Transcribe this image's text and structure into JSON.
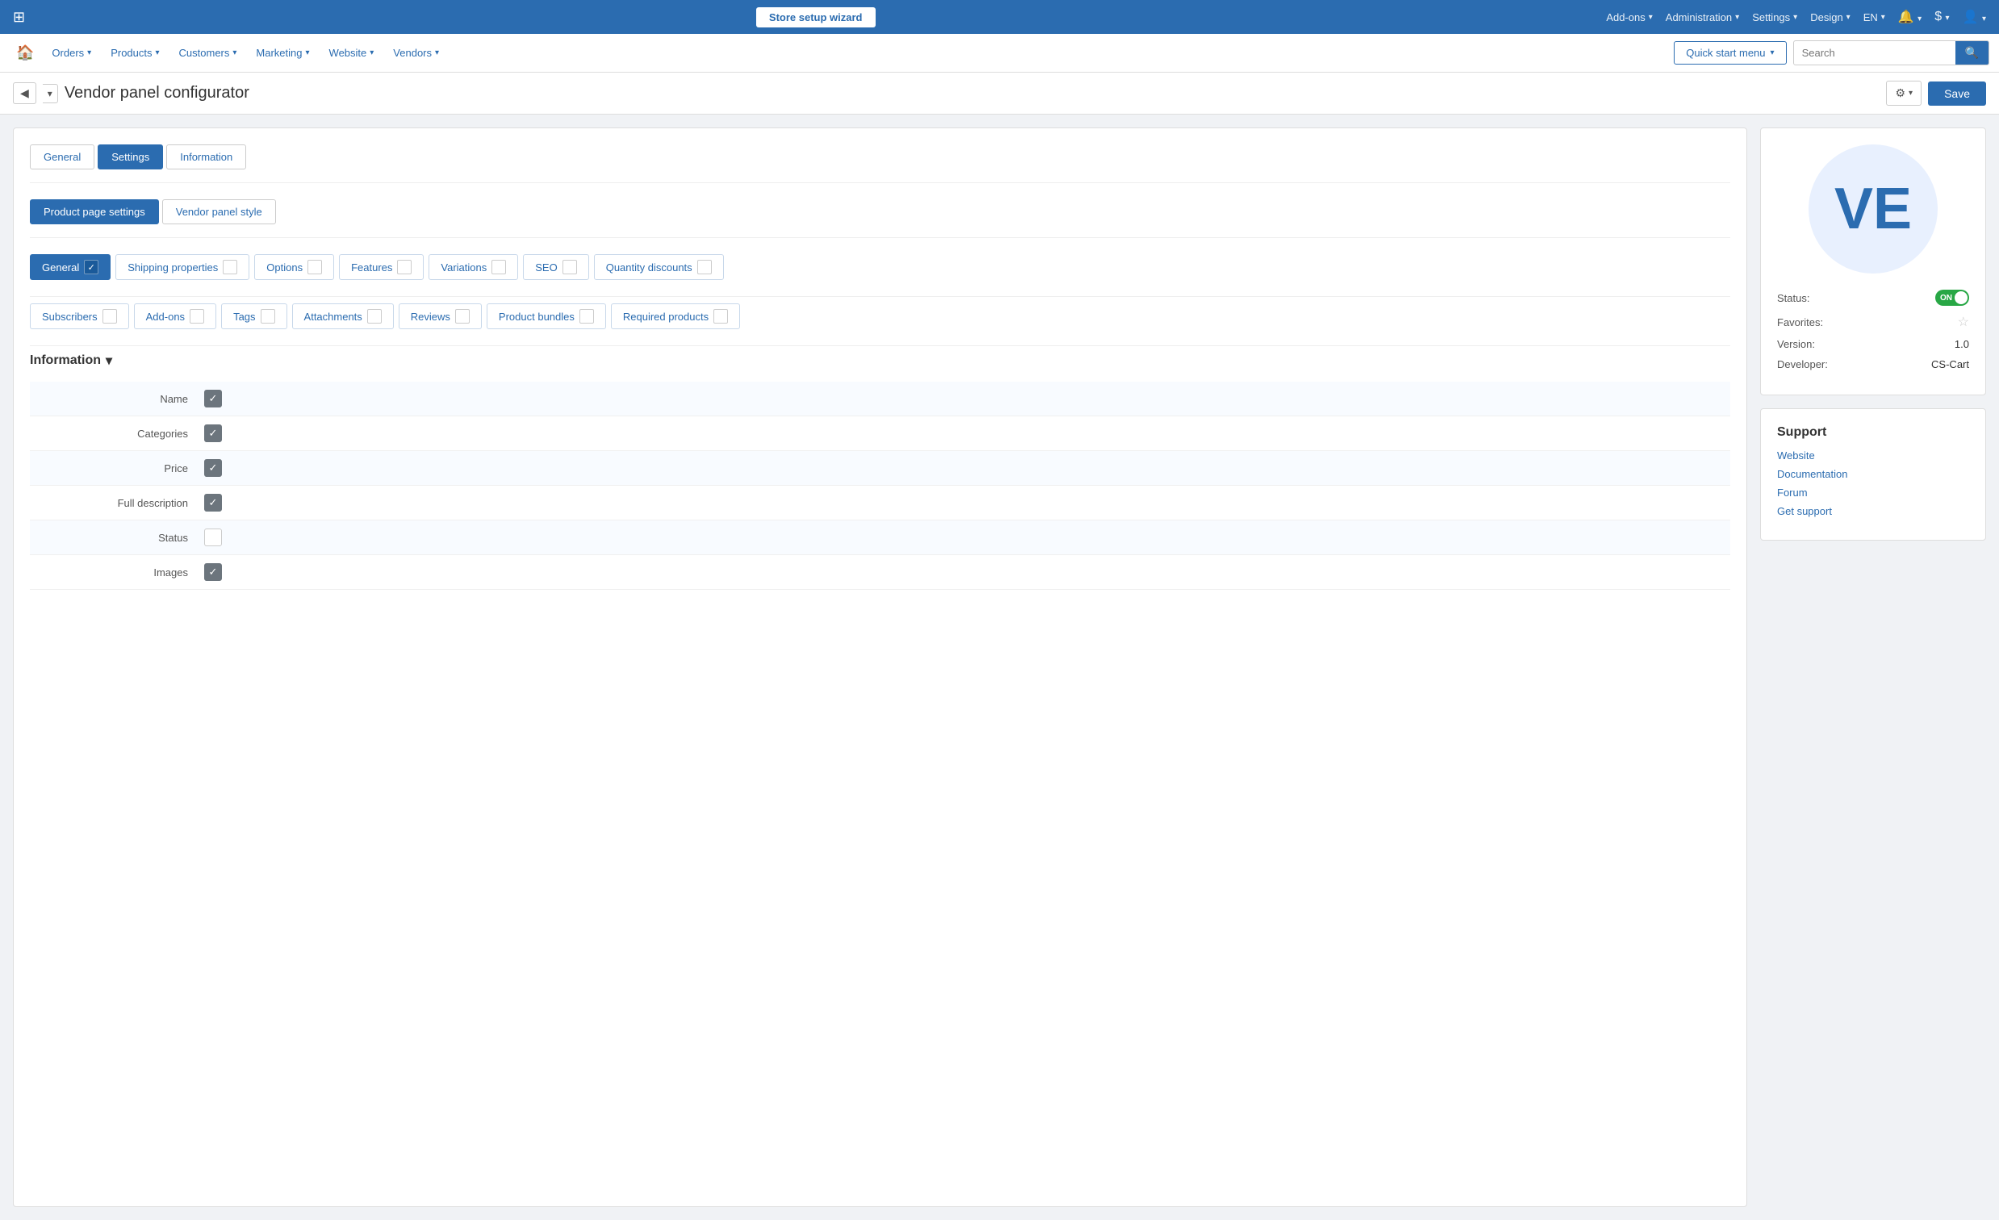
{
  "topbar": {
    "store_setup_label": "Store setup wizard",
    "nav_items": [
      {
        "label": "Add-ons",
        "id": "addons"
      },
      {
        "label": "Administration",
        "id": "administration"
      },
      {
        "label": "Settings",
        "id": "settings"
      },
      {
        "label": "Design",
        "id": "design"
      },
      {
        "label": "EN",
        "id": "lang"
      },
      {
        "label": "🔔",
        "id": "notifications"
      },
      {
        "label": "$",
        "id": "currency"
      },
      {
        "label": "👤",
        "id": "user"
      }
    ]
  },
  "navbar": {
    "home_icon": "⌂",
    "items": [
      {
        "label": "Orders",
        "id": "orders"
      },
      {
        "label": "Products",
        "id": "products"
      },
      {
        "label": "Customers",
        "id": "customers"
      },
      {
        "label": "Marketing",
        "id": "marketing"
      },
      {
        "label": "Website",
        "id": "website"
      },
      {
        "label": "Vendors",
        "id": "vendors"
      }
    ],
    "quick_start_label": "Quick start menu",
    "search_placeholder": "Search"
  },
  "page_header": {
    "title": "Vendor panel configurator",
    "save_label": "Save"
  },
  "tabs": {
    "main": [
      {
        "label": "General",
        "id": "general",
        "active": false
      },
      {
        "label": "Settings",
        "id": "settings",
        "active": true
      },
      {
        "label": "Information",
        "id": "information",
        "active": false
      }
    ],
    "sub": [
      {
        "label": "Product page settings",
        "id": "product-page-settings",
        "active": true
      },
      {
        "label": "Vendor panel style",
        "id": "vendor-panel-style",
        "active": false
      }
    ]
  },
  "feature_pills": {
    "row1": [
      {
        "label": "General",
        "id": "general",
        "active": true,
        "checked": true
      },
      {
        "label": "Shipping properties",
        "id": "shipping",
        "active": false,
        "checked": false
      },
      {
        "label": "Options",
        "id": "options",
        "active": false,
        "checked": false
      },
      {
        "label": "Features",
        "id": "features",
        "active": false,
        "checked": false
      },
      {
        "label": "Variations",
        "id": "variations",
        "active": false,
        "checked": false
      },
      {
        "label": "SEO",
        "id": "seo",
        "active": false,
        "checked": false
      },
      {
        "label": "Quantity discounts",
        "id": "quantity-discounts",
        "active": false,
        "checked": false
      }
    ],
    "row2": [
      {
        "label": "Subscribers",
        "id": "subscribers",
        "active": false,
        "checked": false
      },
      {
        "label": "Add-ons",
        "id": "addons",
        "active": false,
        "checked": false
      },
      {
        "label": "Tags",
        "id": "tags",
        "active": false,
        "checked": false
      },
      {
        "label": "Attachments",
        "id": "attachments",
        "active": false,
        "checked": false
      },
      {
        "label": "Reviews",
        "id": "reviews",
        "active": false,
        "checked": false
      },
      {
        "label": "Product bundles",
        "id": "product-bundles",
        "active": false,
        "checked": false
      },
      {
        "label": "Required products",
        "id": "required-products",
        "active": false,
        "checked": false
      }
    ]
  },
  "information_section": {
    "heading": "Information",
    "fields": [
      {
        "label": "Name",
        "checked": true
      },
      {
        "label": "Categories",
        "checked": true
      },
      {
        "label": "Price",
        "checked": true
      },
      {
        "label": "Full description",
        "checked": true
      },
      {
        "label": "Status",
        "checked": false
      },
      {
        "label": "Images",
        "checked": true
      }
    ]
  },
  "sidebar": {
    "logo_text": "VE",
    "status_label": "Status:",
    "status_value": "ON",
    "favorites_label": "Favorites:",
    "version_label": "Version:",
    "version_value": "1.0",
    "developer_label": "Developer:",
    "developer_value": "CS-Cart",
    "support": {
      "heading": "Support",
      "links": [
        {
          "label": "Website",
          "id": "website"
        },
        {
          "label": "Documentation",
          "id": "documentation"
        },
        {
          "label": "Forum",
          "id": "forum"
        },
        {
          "label": "Get support",
          "id": "get-support"
        }
      ]
    }
  }
}
